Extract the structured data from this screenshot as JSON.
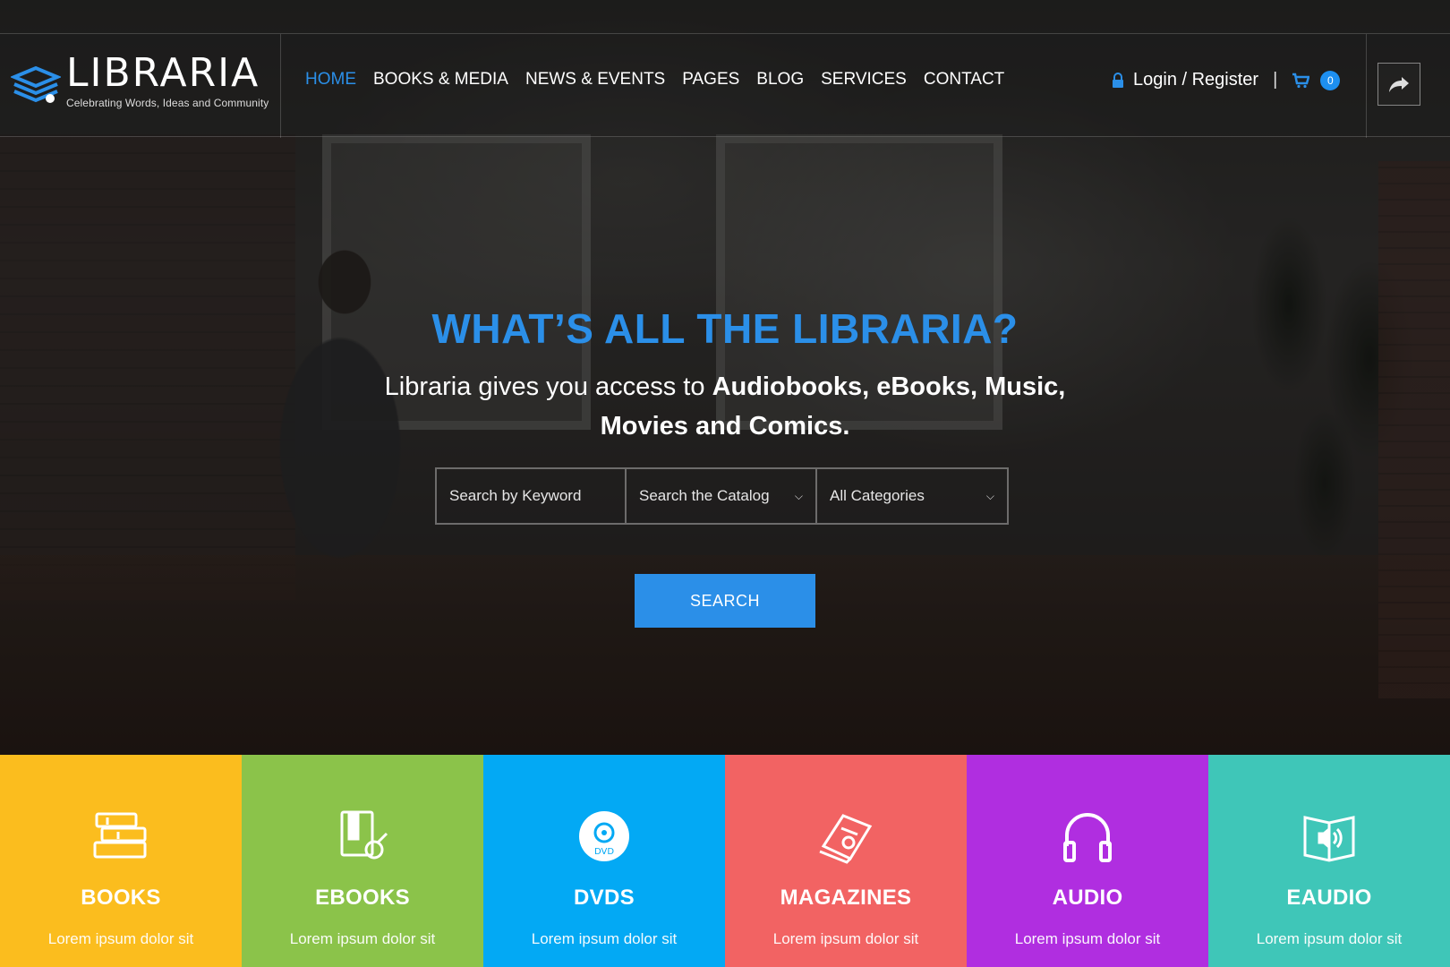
{
  "brand": {
    "name": "LIBRARIA",
    "tagline": "Celebrating Words, Ideas and Community"
  },
  "nav": {
    "items": [
      {
        "label": "HOME",
        "active": true
      },
      {
        "label": "BOOKS & MEDIA",
        "active": false
      },
      {
        "label": "NEWS & EVENTS",
        "active": false
      },
      {
        "label": "PAGES",
        "active": false
      },
      {
        "label": "BLOG",
        "active": false
      },
      {
        "label": "SERVICES",
        "active": false
      },
      {
        "label": "CONTACT",
        "active": false
      }
    ]
  },
  "user": {
    "login_label": "Login / Register",
    "separator": "|",
    "cart_count": "0"
  },
  "hero": {
    "title": "WHAT’S ALL THE LIBRARIA?",
    "subtitle_plain": "Libraria gives you access to ",
    "subtitle_bold_1": "Audiobooks, eBooks, Music,",
    "subtitle_bold_2": "Movies and Comics."
  },
  "search": {
    "keyword_placeholder": "Search by Keyword",
    "catalog_label": "Search the Catalog",
    "category_label": "All Categories",
    "button_label": "SEARCH"
  },
  "categories": [
    {
      "title": "BOOKS",
      "text": "Lorem ipsum dolor sit",
      "color": "#fbbd1e",
      "icon": "books-icon"
    },
    {
      "title": "EBOOKS",
      "text": "Lorem ipsum dolor sit",
      "color": "#8bc34a",
      "icon": "ebook-icon"
    },
    {
      "title": "DVDS",
      "text": "Lorem ipsum dolor sit",
      "color": "#03a9f4",
      "icon": "dvd-icon"
    },
    {
      "title": "MAGAZINES",
      "text": "Lorem ipsum dolor sit",
      "color": "#f26363",
      "icon": "magazine-icon"
    },
    {
      "title": "AUDIO",
      "text": "Lorem ipsum dolor sit",
      "color": "#b02ee0",
      "icon": "headphones-icon"
    },
    {
      "title": "EAUDIO",
      "text": "Lorem ipsum dolor sit",
      "color": "#3fc6b8",
      "icon": "eaudio-book-icon"
    }
  ],
  "colors": {
    "accent": "#2b8fe8",
    "badge": "#1d8ff0"
  }
}
